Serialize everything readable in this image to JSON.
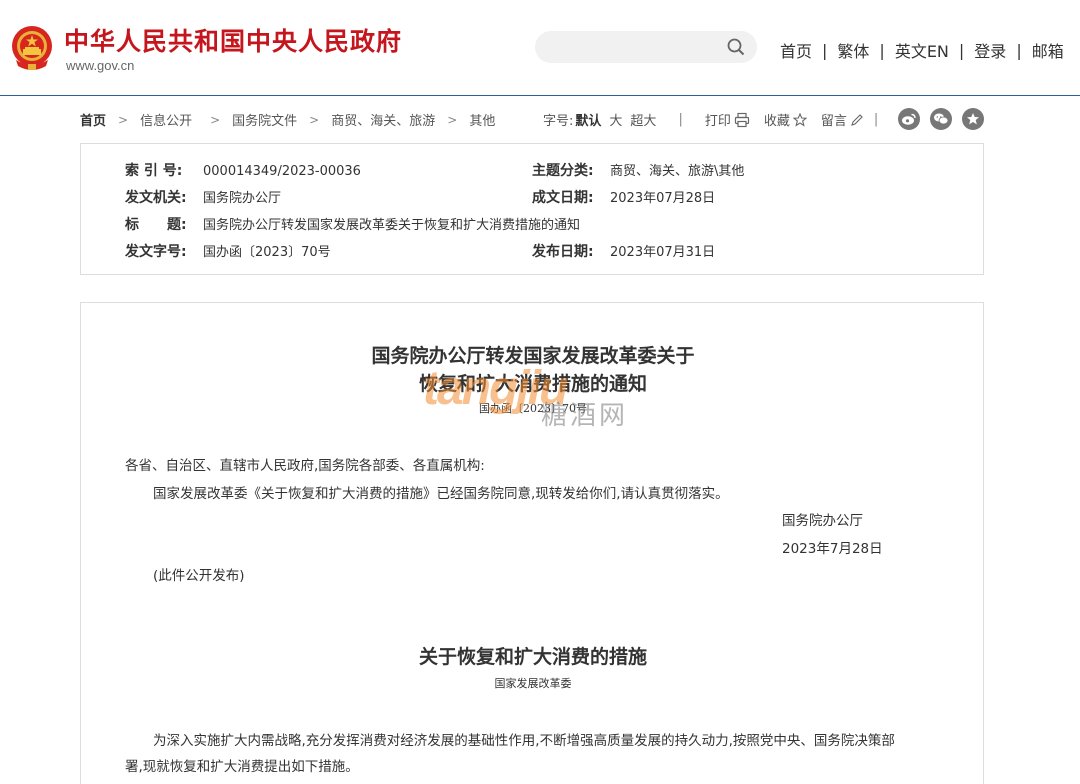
{
  "header": {
    "site_title": "中华人民共和国中央人民政府",
    "site_url": "www.gov.cn",
    "search": {
      "placeholder": ""
    },
    "nav": [
      "首页",
      "繁体",
      "英文EN",
      "登录",
      "邮箱"
    ],
    "nav_separator": "|"
  },
  "breadcrumb": {
    "items": [
      "首页",
      "信息公开",
      "国务院文件",
      "商贸、海关、旅游",
      "其他"
    ]
  },
  "tools": {
    "font_size_label": "字号:",
    "font_default": "默认",
    "font_large": "大",
    "font_xlarge": "超大",
    "print_label": "打印",
    "favorite_label": "收藏",
    "comment_label": "留言",
    "separator": "|"
  },
  "info": {
    "index_label": "索 引 号:",
    "index_value": "000014349/2023-00036",
    "topic_label": "主题分类:",
    "topic_value": "商贸、海关、旅游\\其他",
    "issuer_label": "发文机关:",
    "issuer_value": "国务院办公厅",
    "written_date_label": "成文日期:",
    "written_date_value": "2023年07月28日",
    "title_label": "标　　题:",
    "title_value": "国务院办公厅转发国家发展改革委关于恢复和扩大消费措施的通知",
    "doc_number_label": "发文字号:",
    "doc_number_value": "国办函〔2023〕70号",
    "publish_date_label": "发布日期:",
    "publish_date_value": "2023年07月31日"
  },
  "document": {
    "title_line1": "国务院办公厅转发国家发展改革委关于",
    "title_line2": "恢复和扩大消费措施的通知",
    "number": "国办函〔2023〕70号",
    "salutation": "各省、自治区、直辖市人民政府,国务院各部委、各直属机构:",
    "body": "国家发展改革委《关于恢复和扩大消费的措施》已经国务院同意,现转发给你们,请认真贯彻落实。",
    "signer": "国务院办公厅",
    "sign_date": "2023年7月28日",
    "public_note": "(此件公开发布)",
    "section_title": "关于恢复和扩大消费的措施",
    "section_author": "国家发展改革委",
    "section_para_line1": "为深入实施扩大内需战略,充分发挥消费对经济发展的基础性作用,不断增强高质量发展的持久动力,按照党中央、国务院决策部",
    "section_para_line2": "署,现就恢复和扩大消费提出如下措施。"
  },
  "watermark": {
    "latin": "tangjiu",
    "cn": "糖酒网"
  },
  "colors": {
    "brand_red": "#c4161c",
    "header_border": "#2d5f9a",
    "watermark_orange": "#f08c32"
  }
}
